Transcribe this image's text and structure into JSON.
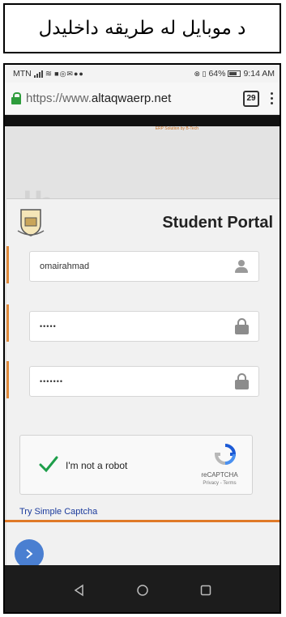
{
  "caption": {
    "text": "د موبایل له طریقه داخلیدل"
  },
  "status_bar": {
    "carrier": "MTN",
    "battery": "64%",
    "time": "9:14 AM"
  },
  "browser": {
    "url_prefix": "https://www.",
    "url_domain": "altaqwaerp.net",
    "tab_count": "29"
  },
  "page": {
    "banner_tagline": "ERP Solution by B-Tech",
    "portal_title": "Student Portal",
    "username_value": "omairahmad",
    "password_mask": "•••••",
    "captcha_field_mask": "•••••••",
    "captcha": {
      "label": "I'm not a robot",
      "brand": "reCAPTCHA",
      "links": "Privacy - Terms",
      "checked": true
    },
    "simple_captcha_link": "Try Simple Captcha"
  },
  "colors": {
    "accent_orange": "#e07a28",
    "lock_green": "#2e9c3c",
    "link_blue": "#1a3a9c",
    "next_button_blue": "#4a7fd1"
  }
}
